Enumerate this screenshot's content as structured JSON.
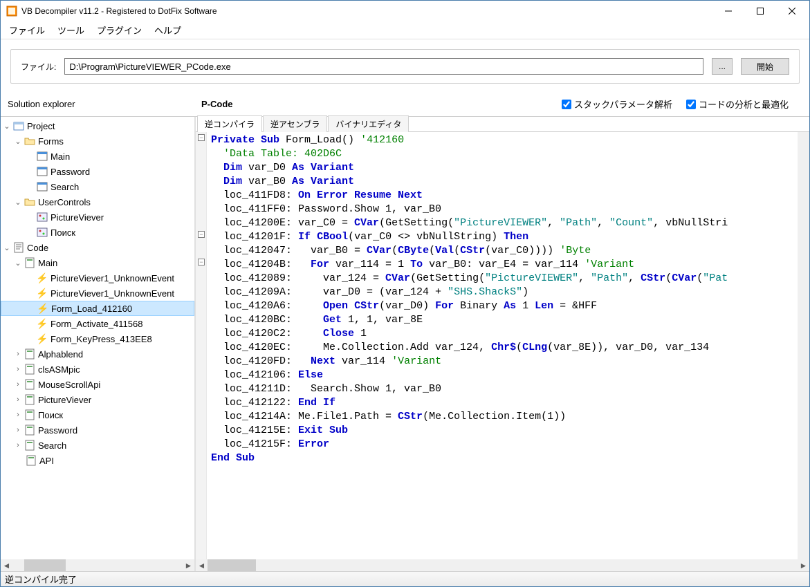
{
  "title": "VB Decompiler v11.2 - Registered to DotFix Software",
  "menu": {
    "file": "ファイル",
    "tools": "ツール",
    "plugins": "プラグイン",
    "help": "ヘルプ"
  },
  "toolbar": {
    "file_label": "ファイル:",
    "path_value": "D:\\Program\\PictureVIEWER_PCode.exe",
    "browse": "...",
    "start": "開始"
  },
  "panels": {
    "solution_explorer": "Solution explorer",
    "pcode": "P-Code",
    "chk_stack": "スタックパラメータ解析",
    "chk_opt": "コードの分析と最適化"
  },
  "tree": {
    "project": "Project",
    "forms": "Forms",
    "form_main": "Main",
    "form_password": "Password",
    "form_search": "Search",
    "usercontrols": "UserControls",
    "uc_pictureviewer": "PictureViever",
    "uc_poisk": "Поиск",
    "code": "Code",
    "code_main": "Main",
    "ev_pv1a": "PictureViever1_UnknownEvent",
    "ev_pv1b": "PictureViever1_UnknownEvent",
    "ev_formload": "Form_Load_412160",
    "ev_formactivate": "Form_Activate_411568",
    "ev_formkeypress": "Form_KeyPress_413EE8",
    "mod_alphablend": "Alphablend",
    "mod_clsasmpic": "clsASMpic",
    "mod_mousescroll": "MouseScrollApi",
    "mod_pictureviewer": "PictureViever",
    "mod_poisk": "Поиск",
    "mod_password": "Password",
    "mod_search": "Search",
    "mod_api": "API"
  },
  "tabs": {
    "decompile": "逆コンパイラ",
    "disasm": "逆アセンブラ",
    "binedit": "バイナリエディタ"
  },
  "status": "逆コンパイル完了"
}
